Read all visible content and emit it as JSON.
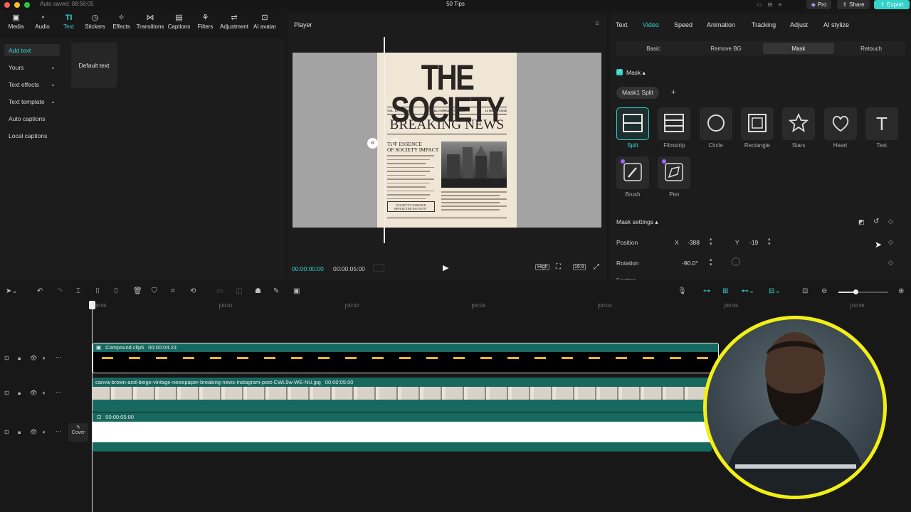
{
  "window": {
    "title": "50 Tips",
    "autosave": "Auto saved: 08:56:05",
    "pro_label": "Pro",
    "share_label": "Share",
    "export_label": "Export"
  },
  "toolbar": {
    "items": [
      {
        "label": "Media",
        "icon": "media-icon"
      },
      {
        "label": "Audio",
        "icon": "audio-icon"
      },
      {
        "label": "Text",
        "icon": "text-icon"
      },
      {
        "label": "Stickers",
        "icon": "sticker-icon"
      },
      {
        "label": "Effects",
        "icon": "effects-icon"
      },
      {
        "label": "Transitions",
        "icon": "transitions-icon"
      },
      {
        "label": "Captions",
        "icon": "captions-icon"
      },
      {
        "label": "Filters",
        "icon": "filters-icon"
      },
      {
        "label": "Adjustment",
        "icon": "adjustment-icon"
      },
      {
        "label": "AI avatar",
        "icon": "ai-avatar-icon"
      }
    ],
    "active": "Text"
  },
  "left_panel": {
    "items": [
      "Add text",
      "Yours",
      "Text effects",
      "Text template",
      "Auto captions",
      "Local captions"
    ],
    "default_card": "Default text"
  },
  "player": {
    "title": "Player",
    "time_current": "00:00:00:00",
    "time_total": "00:00:05:00",
    "quality": "High",
    "ratio": "16:9",
    "newspaper": {
      "masthead": "THE SOCIETY",
      "vol": "VOL. 10, NO.198",
      "site": "REALLYGREATSITE.COM",
      "date": "12 MARCH 2026",
      "headline": "BREAKING NEWS",
      "subhead1": "THE ESSENCE",
      "subhead2": "OF SOCIETY IMPACT",
      "quote1": "\"SOCIETY'S ESSENCE,",
      "quote2": "REFLECTED IN UNITY.\""
    }
  },
  "right_panel": {
    "tabs": [
      "Text",
      "Video",
      "Speed",
      "Animation",
      "Tracking",
      "Adjust",
      "AI stylize"
    ],
    "active_tab": "Video",
    "subtabs": [
      "Basic",
      "Remove BG",
      "Mask",
      "Retouch"
    ],
    "active_subtab": "Mask",
    "mask_label": "Mask",
    "mask_chip": "Mask1 Split",
    "masks": [
      "Split",
      "Filmstrip",
      "Circle",
      "Rectangle",
      "Stars",
      "Heart",
      "Text",
      "Brush",
      "Pen"
    ],
    "settings_label": "Mask settings",
    "position_label": "Position",
    "x_label": "X",
    "x_value": "-388",
    "y_label": "Y",
    "y_value": "-19",
    "rotation_label": "Rotation",
    "rotation_value": "-90.0°",
    "feather_label": "Feather"
  },
  "timeline": {
    "ruler": [
      "00:00",
      "00:01",
      "00:02",
      "00:03",
      "00:04",
      "00:05",
      "00:06"
    ],
    "clip1_name": "Compound clip5",
    "clip1_duration": "00:00:04:23",
    "clip2_name": "canva-brown-and-beige-vintage-newspaper-breaking-news-instagram-post-CWL5w-WE-NU.jpg",
    "clip2_duration": "00:00:05:00",
    "clip3_duration": "00:00:05:00",
    "cover_label": "Cover"
  },
  "colors": {
    "accent": "#35d2c9",
    "clip_teal": "#17695f",
    "avatar_ring": "#f2ef14"
  }
}
